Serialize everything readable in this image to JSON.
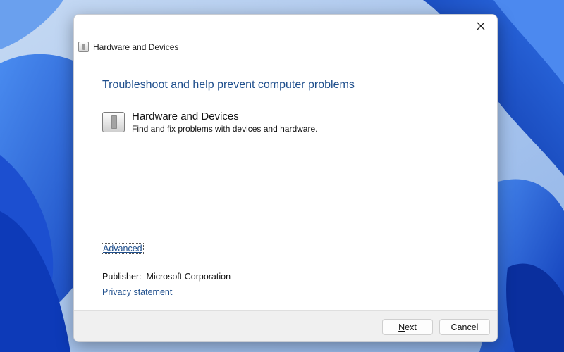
{
  "window": {
    "title": "Hardware and Devices",
    "close_icon": "close-icon"
  },
  "main": {
    "heading": "Troubleshoot and help prevent computer problems",
    "item": {
      "title": "Hardware and Devices",
      "description": "Find and fix problems with devices and hardware.",
      "icon": "hardware-device-icon"
    },
    "advanced_link": "Advanced",
    "publisher_label": "Publisher:",
    "publisher_value": "Microsoft Corporation",
    "privacy_link": "Privacy statement"
  },
  "footer": {
    "next_access_key": "N",
    "next_rest": "ext",
    "cancel_label": "Cancel"
  },
  "colors": {
    "link": "#1e4e8c",
    "heading": "#1e4e8c",
    "footer_bg": "#f0f0f0",
    "wallpaper_accent": "#1a56d6"
  }
}
